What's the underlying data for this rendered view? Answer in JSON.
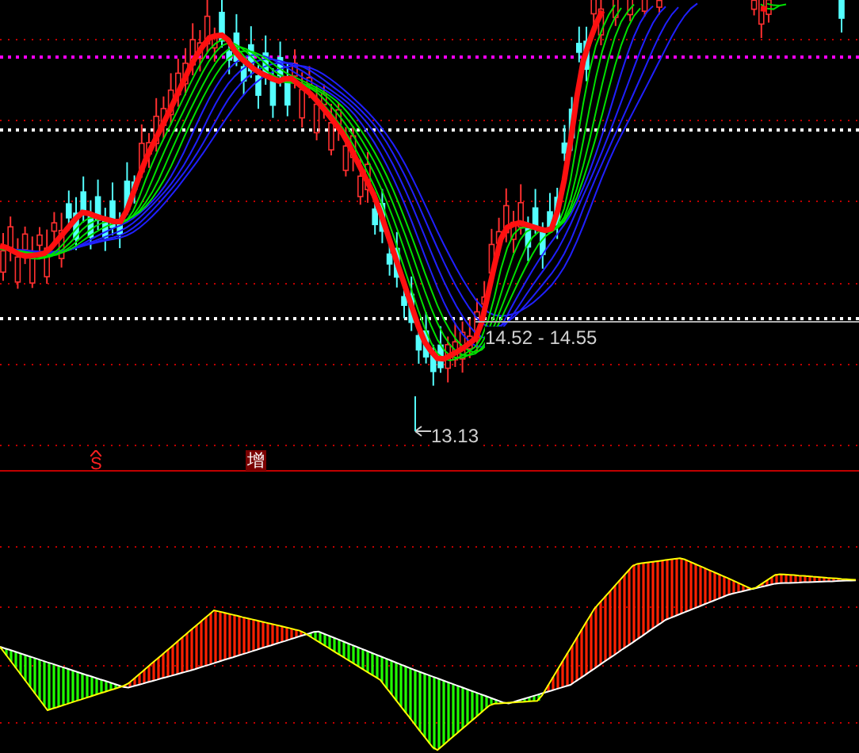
{
  "price_panel": {
    "annotations": [
      {
        "kind": "range",
        "text": "14.52 - 14.55"
      },
      {
        "kind": "low",
        "text": "13.13"
      }
    ],
    "signals": [
      {
        "kind": "buy",
        "text": "S"
      },
      {
        "kind": "add",
        "text": "增"
      }
    ]
  }
}
